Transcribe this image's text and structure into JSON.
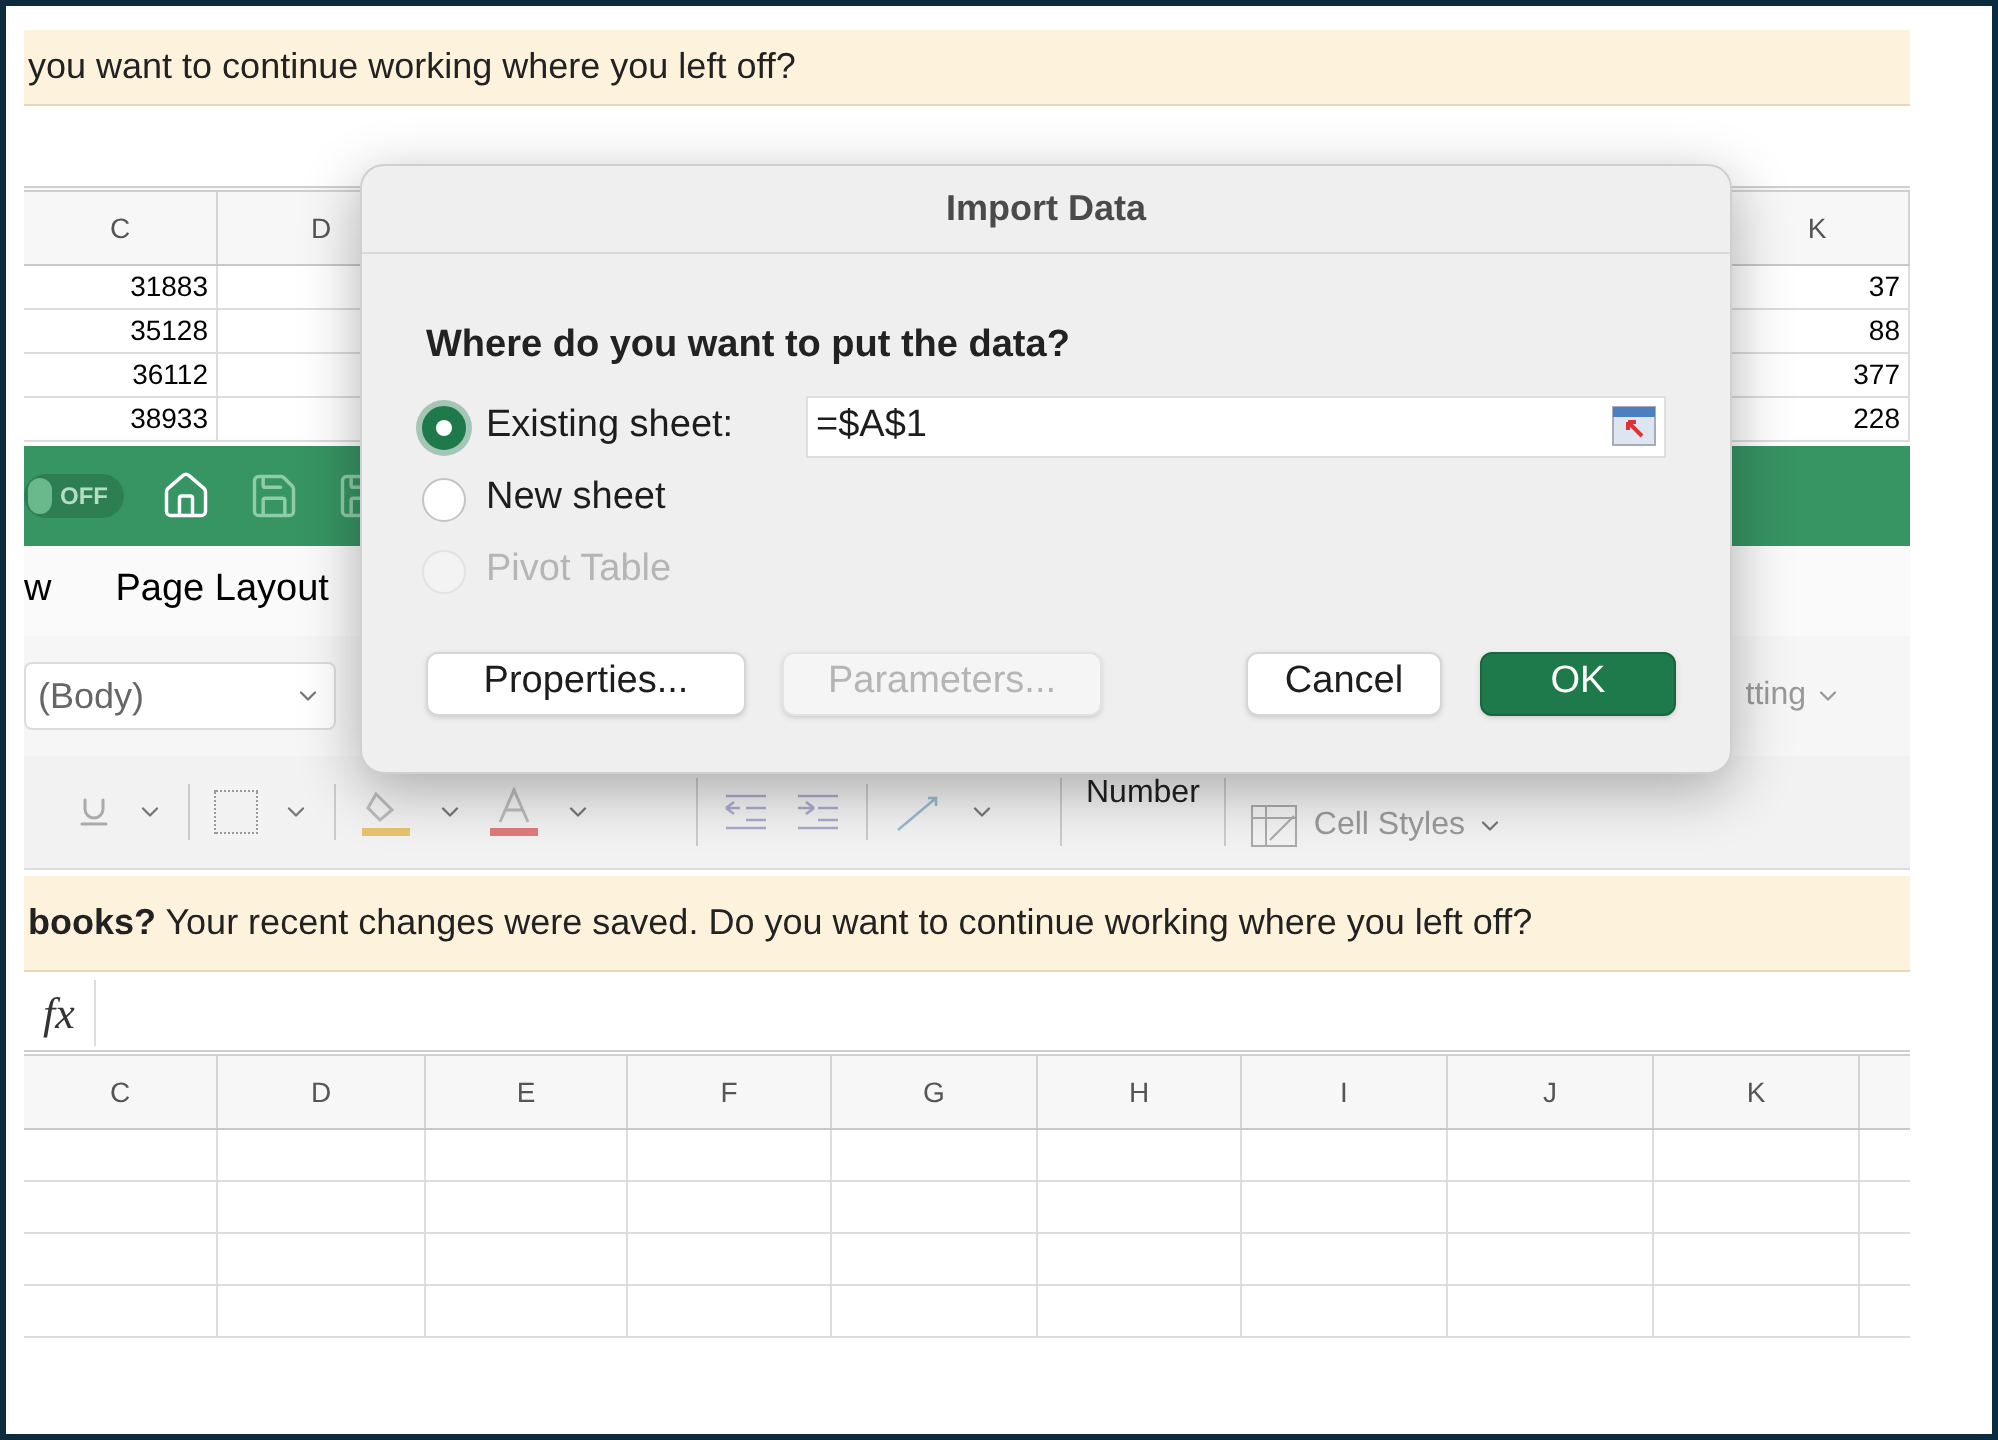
{
  "banners": [
    {
      "text": "you want to continue working where you left off?"
    },
    {
      "text": "**books?**  Your recent changes were saved. Do you want to continue working where you left off?"
    }
  ],
  "top_sheet": {
    "columns": [
      "C",
      "D",
      "K"
    ],
    "rows": [
      {
        "c": "31883",
        "k": "37"
      },
      {
        "c": "35128",
        "k": "88"
      },
      {
        "c": "36112",
        "k": "377"
      },
      {
        "c": "38933",
        "k": "228"
      }
    ]
  },
  "ribbon": {
    "autosave": {
      "label": "OFF",
      "on": false
    },
    "tabs": [
      {
        "label": "w",
        "selected": false
      },
      {
        "label": "Page Layout",
        "selected": false
      }
    ],
    "font_box": {
      "value": "(Body)"
    },
    "number_label": "Number",
    "cell_styles": "Cell Styles",
    "formatting_label": "tting"
  },
  "formula_bar": {
    "label": "fx"
  },
  "bottom_sheet": {
    "columns": [
      "C",
      "D",
      "E",
      "F",
      "G",
      "H",
      "I",
      "J",
      "K"
    ]
  },
  "dialog": {
    "title": "Import Data",
    "question": "Where do you want to put the data?",
    "options": [
      {
        "label": "Existing sheet:",
        "selected": true,
        "disabled": false
      },
      {
        "label": "New sheet",
        "selected": false,
        "disabled": false
      },
      {
        "label": "Pivot Table",
        "selected": false,
        "disabled": true
      }
    ],
    "destination": {
      "value": "=$A$1"
    },
    "buttons": [
      {
        "label": "Properties...",
        "kind": "default",
        "disabled": false
      },
      {
        "label": "Parameters...",
        "kind": "default",
        "disabled": true
      },
      {
        "label": "Cancel",
        "kind": "default",
        "disabled": false
      },
      {
        "label": "OK",
        "kind": "primary",
        "disabled": false
      }
    ]
  }
}
